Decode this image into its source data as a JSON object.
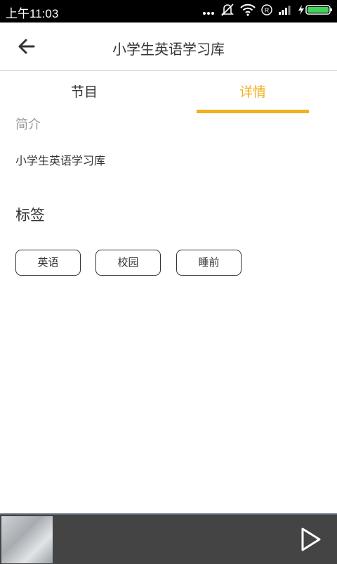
{
  "status_bar": {
    "time": "上午11:03"
  },
  "app_bar": {
    "title": "小学生英语学习库"
  },
  "tabs": [
    {
      "label": "节目"
    },
    {
      "label": "详情"
    }
  ],
  "active_tab": "详情",
  "intro": {
    "label": "简介",
    "text": "小学生英语学习库"
  },
  "tags": {
    "heading": "标签",
    "items": [
      "英语",
      "校园",
      "睡前"
    ]
  },
  "colors": {
    "accent": "#f2b01e",
    "status_bar": "#000000",
    "player_bar": "#444444"
  },
  "icons": [
    "back-arrow-icon",
    "more-dots-icon",
    "mute-icon",
    "wifi-icon",
    "registered-icon",
    "signal-icon",
    "battery-charging-icon",
    "play-icon"
  ]
}
